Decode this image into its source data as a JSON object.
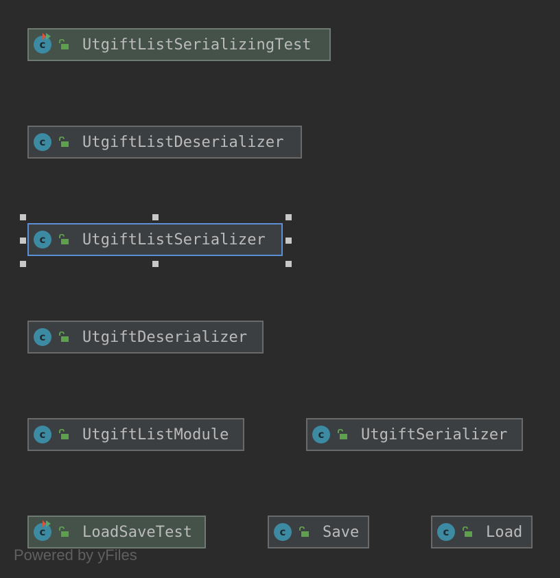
{
  "diagram": {
    "nodes": [
      {
        "id": "n1",
        "label": "UtgiftListSerializingTest",
        "kind": "test-class",
        "icon": "class-icon",
        "visibility_icon": "public-lock-icon"
      },
      {
        "id": "n2",
        "label": "UtgiftListDeserializer",
        "kind": "class",
        "icon": "class-icon",
        "visibility_icon": "public-lock-icon"
      },
      {
        "id": "n3",
        "label": "UtgiftListSerializer",
        "kind": "class",
        "icon": "class-icon",
        "visibility_icon": "public-lock-icon",
        "selected": true
      },
      {
        "id": "n4",
        "label": "UtgiftDeserializer",
        "kind": "class",
        "icon": "class-icon",
        "visibility_icon": "public-lock-icon"
      },
      {
        "id": "n5",
        "label": "UtgiftListModule",
        "kind": "class",
        "icon": "class-icon",
        "visibility_icon": "public-lock-icon"
      },
      {
        "id": "n6",
        "label": "UtgiftSerializer",
        "kind": "class",
        "icon": "class-icon",
        "visibility_icon": "public-lock-icon"
      },
      {
        "id": "n7",
        "label": "LoadSaveTest",
        "kind": "test-class",
        "icon": "class-icon",
        "visibility_icon": "public-lock-icon"
      },
      {
        "id": "n8",
        "label": "Save",
        "kind": "class",
        "icon": "class-icon",
        "visibility_icon": "public-lock-icon"
      },
      {
        "id": "n9",
        "label": "Load",
        "kind": "class",
        "icon": "class-icon",
        "visibility_icon": "public-lock-icon"
      }
    ],
    "icon_letter": "c",
    "footer": "Powered by yFiles"
  },
  "colors": {
    "background": "#2b2b2b",
    "node_fill": "#3c3f41",
    "test_node_fill": "#44524a",
    "node_border": "#6a6a6a",
    "selection_border": "#5c8fd6",
    "class_icon": "#3d8aa3",
    "lock_icon": "#5fa04e",
    "run_marker_green": "#59a869",
    "run_marker_red": "#e0533a",
    "label_text": "#bbbbbb",
    "footer_text": "#606060"
  }
}
